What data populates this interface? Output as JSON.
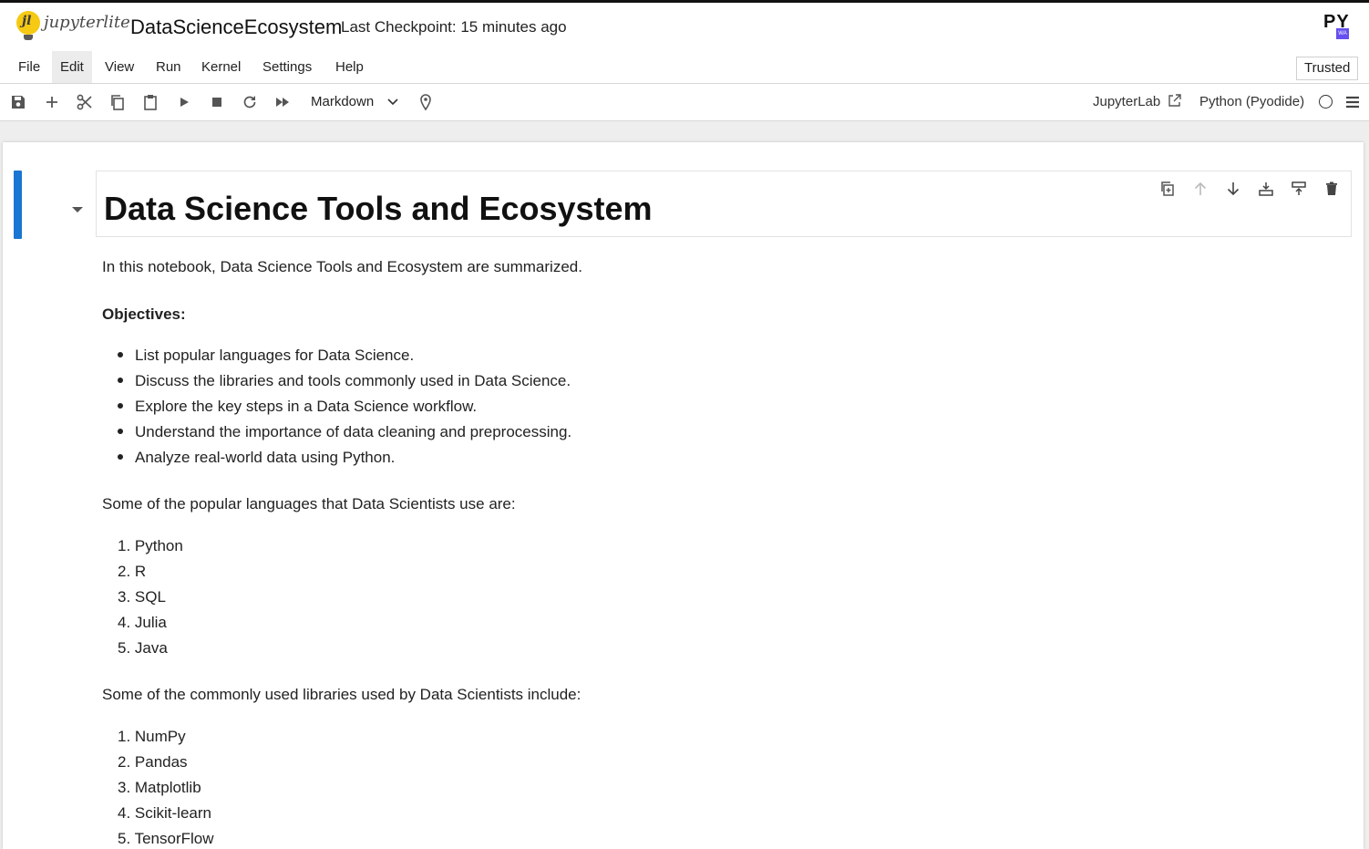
{
  "header": {
    "logo_badge": "jl",
    "logo_text": "jupyterlite",
    "notebook_title": "DataScienceEcosystem",
    "checkpoint": "Last Checkpoint: 15 minutes ago",
    "pyodide_logo": "PY",
    "pyodide_badge": "WA"
  },
  "menubar": {
    "items": [
      "File",
      "Edit",
      "View",
      "Run",
      "Kernel",
      "Settings",
      "Help"
    ],
    "active": "Edit",
    "trusted": "Trusted"
  },
  "toolbar": {
    "icons": [
      "save-icon",
      "add-cell-icon",
      "cut-icon",
      "copy-icon",
      "paste-icon",
      "run-icon",
      "stop-icon",
      "restart-icon",
      "fast-forward-icon",
      "cell-type-select",
      "debug-pin-icon"
    ],
    "cell_type": "Markdown",
    "jupyterlab_link": "JupyterLab",
    "kernel_name": "Python (Pyodide)"
  },
  "notebook": {
    "heading": "Data Science Tools and Ecosystem",
    "intro": "In this notebook, Data Science Tools and Ecosystem are summarized.",
    "objectives_label": "Objectives:",
    "objectives": [
      "List popular languages for Data Science.",
      "Discuss the libraries and tools commonly used in Data Science.",
      "Explore the key steps in a Data Science workflow.",
      "Understand the importance of data cleaning and preprocessing.",
      "Analyze real-world data using Python."
    ],
    "languages_intro": "Some of the popular languages that Data Scientists use are:",
    "languages": [
      "1. Python",
      "2. R",
      "3. SQL",
      "4. Julia",
      "5. Java"
    ],
    "libraries_intro": "Some of the commonly used libraries used by Data Scientists include:",
    "libraries": [
      "1. NumPy",
      "2. Pandas",
      "3. Matplotlib",
      "4. Scikit-learn",
      "5. TensorFlow"
    ]
  },
  "colors": {
    "active_cell_bar": "#1976d2",
    "logo_yellow": "#f6c913",
    "pyodide_purple": "#654ff0"
  }
}
